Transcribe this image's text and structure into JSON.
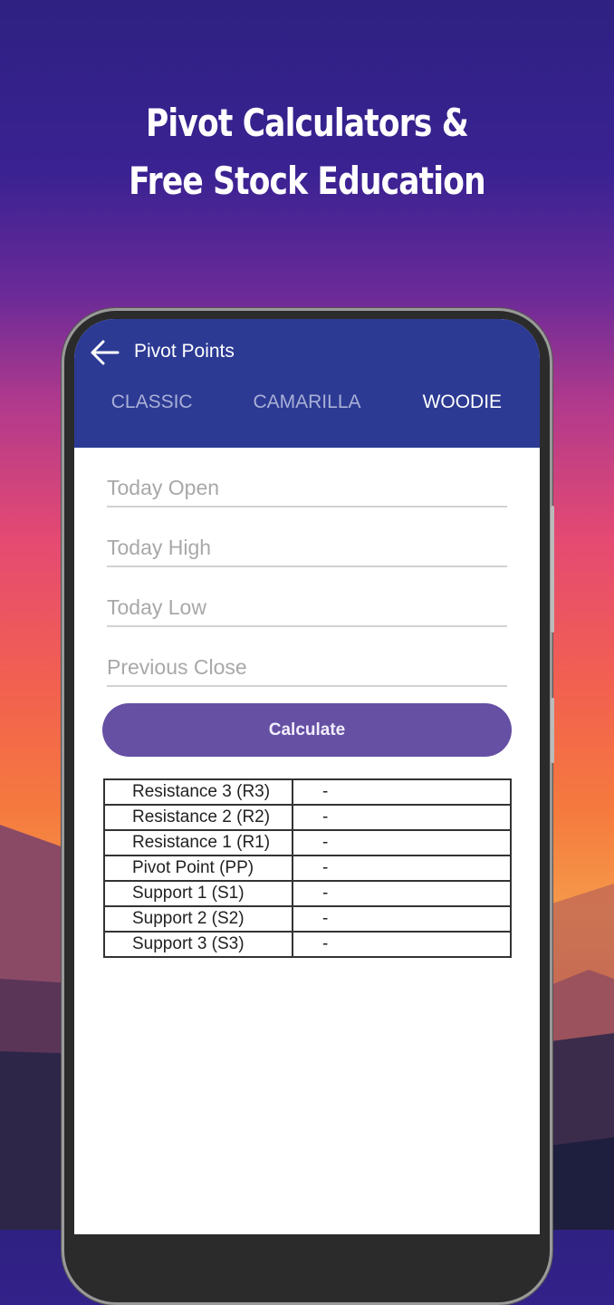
{
  "promo": {
    "headline_line1": "Pivot Calculators &",
    "headline_line2": "Free Stock Education"
  },
  "app": {
    "title": "Pivot Points",
    "back_icon": "arrow-left-icon",
    "tabs": [
      {
        "label": "CLASSIC",
        "active": false
      },
      {
        "label": "CAMARILLA",
        "active": false
      },
      {
        "label": "WOODIE",
        "active": true
      }
    ],
    "inputs": [
      {
        "placeholder": "Today Open",
        "value": ""
      },
      {
        "placeholder": "Today High",
        "value": ""
      },
      {
        "placeholder": "Today Low",
        "value": ""
      },
      {
        "placeholder": "Previous Close",
        "value": ""
      }
    ],
    "calculate_label": "Calculate",
    "results": [
      {
        "label": "Resistance 3 (R3)",
        "value": "-"
      },
      {
        "label": "Resistance 2 (R2)",
        "value": "-"
      },
      {
        "label": "Resistance 1 (R1)",
        "value": "-"
      },
      {
        "label": "Pivot Point (PP)",
        "value": "-"
      },
      {
        "label": "Support 1 (S1)",
        "value": "-"
      },
      {
        "label": "Support 2 (S2)",
        "value": "-"
      },
      {
        "label": "Support 3 (S3)",
        "value": "-"
      }
    ]
  },
  "colors": {
    "appbar": "#2c3a94",
    "button": "#6650a4",
    "tab_active": "#ffffff",
    "tab_inactive": "#a9b0d6"
  }
}
